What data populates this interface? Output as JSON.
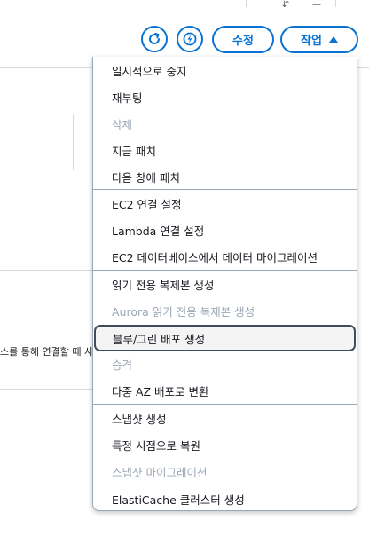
{
  "toolbar": {
    "refresh_icon": "refresh-icon",
    "lightning_icon": "lightning-icon",
    "modify_label": "수정",
    "actions_label": "작업",
    "accent": "#0972d3"
  },
  "background": {
    "snippet_text": "스를 통해 연결할 때 사"
  },
  "menu": {
    "groups": [
      [
        "일시적으로 중지",
        "재부팅",
        "삭제",
        "지금 패치",
        "다음 창에 패치"
      ],
      [
        "EC2 연결 설정",
        "Lambda 연결 설정",
        "EC2 데이터베이스에서 데이터 마이그레이션"
      ],
      [
        "읽기 전용 복제본 생성",
        "Aurora 읽기 전용 복제본 생성",
        "블루/그린 배포 생성",
        "승격",
        "다중 AZ 배포로 변환"
      ],
      [
        "스냅샷 생성",
        "특정 시점으로 복원",
        "스냅샷 마이그레이션"
      ],
      [
        "ElastiCache 클러스터 생성"
      ]
    ],
    "disabled_items": [
      "삭제",
      "Aurora 읽기 전용 복제본 생성",
      "승격",
      "스냅샷 마이그레이션"
    ],
    "hovered_item": "블루/그린 배포 생성"
  }
}
